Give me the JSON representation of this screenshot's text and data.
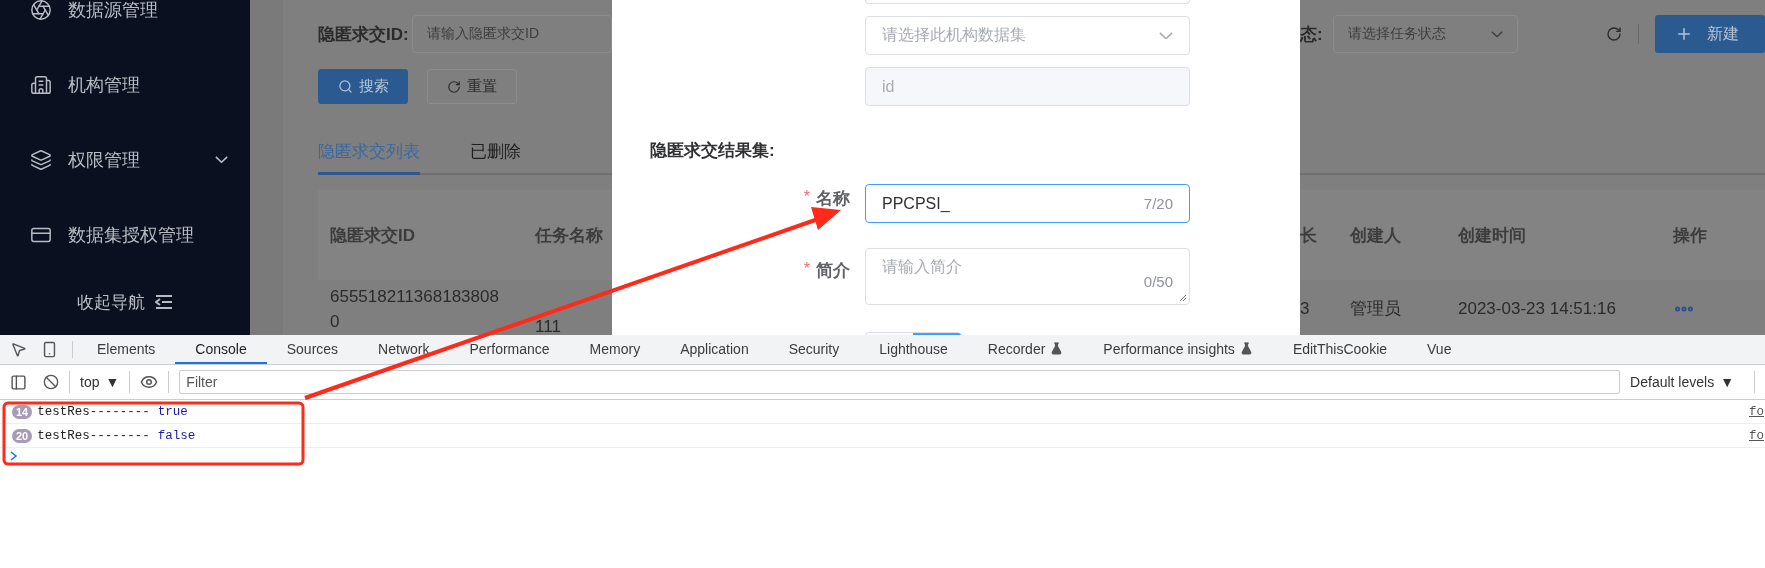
{
  "sidebar": {
    "items": [
      {
        "label": "数据源管理",
        "kind": "link"
      },
      {
        "label": "机构管理",
        "kind": "link"
      },
      {
        "label": "权限管理",
        "kind": "group",
        "expanded": false
      },
      {
        "label": "数据集授权管理",
        "kind": "link"
      }
    ],
    "collapse_label": "收起导航"
  },
  "page": {
    "filter": {
      "label": "隐匿求交ID:",
      "placeholder": "请输入隐匿求交ID"
    },
    "buttons": [
      {
        "label": "搜索",
        "kind": "primary"
      },
      {
        "label": "重置",
        "kind": "default"
      }
    ],
    "tabs": [
      {
        "label": "隐匿求交列表",
        "selected": true
      },
      {
        "label": "已删除",
        "selected": false
      }
    ],
    "left_table": {
      "columns": [
        "隐匿求交ID",
        "任务名称"
      ],
      "rows": [
        [
          "6555182113681838080",
          "111"
        ]
      ]
    },
    "right": {
      "filter": {
        "label": "态:",
        "placeholder": "请选择任务状态"
      },
      "new_button": "新建",
      "columns": [
        "长",
        "创建人",
        "创建时间",
        "操作"
      ],
      "rows": [
        [
          "3",
          "管理员",
          "2023-03-23 14:51:16"
        ]
      ]
    }
  },
  "modal": {
    "dataset_select": {
      "placeholder": "请选择此机构数据集"
    },
    "id_field": {
      "placeholder": "id",
      "disabled": true
    },
    "section_title": "隐匿求交结果集:",
    "fields": [
      {
        "kind": "input",
        "required_mark": "*",
        "label": "名称",
        "value": "PPCPSI_",
        "counter": "7/20",
        "focused": true
      },
      {
        "kind": "textarea",
        "required_mark": "*",
        "label": "简介",
        "placeholder": "请输入简介",
        "counter": "0/50",
        "focused": false
      }
    ]
  },
  "devtools": {
    "tabs": [
      {
        "label": "Elements",
        "selected": false,
        "experimental": false
      },
      {
        "label": "Console",
        "selected": true,
        "experimental": false
      },
      {
        "label": "Sources",
        "selected": false,
        "experimental": false
      },
      {
        "label": "Network",
        "selected": false,
        "experimental": false
      },
      {
        "label": "Performance",
        "selected": false,
        "experimental": false
      },
      {
        "label": "Memory",
        "selected": false,
        "experimental": false
      },
      {
        "label": "Application",
        "selected": false,
        "experimental": false
      },
      {
        "label": "Security",
        "selected": false,
        "experimental": false
      },
      {
        "label": "Lighthouse",
        "selected": false,
        "experimental": false
      },
      {
        "label": "Recorder",
        "selected": false,
        "experimental": true
      },
      {
        "label": "Performance insights",
        "selected": false,
        "experimental": true
      },
      {
        "label": "EditThisCookie",
        "selected": false,
        "experimental": false
      },
      {
        "label": "Vue",
        "selected": false,
        "experimental": false
      }
    ],
    "context": {
      "label": "top",
      "caret": "▼"
    },
    "filter": {
      "placeholder": "Filter"
    },
    "levels": {
      "label": "Default levels",
      "caret": "▼"
    },
    "messages": [
      {
        "count": "14",
        "text": "testRes--------",
        "value": "true",
        "source": "fo"
      },
      {
        "count": "20",
        "text": "testRes--------",
        "value": "false",
        "source": "fo"
      }
    ]
  }
}
